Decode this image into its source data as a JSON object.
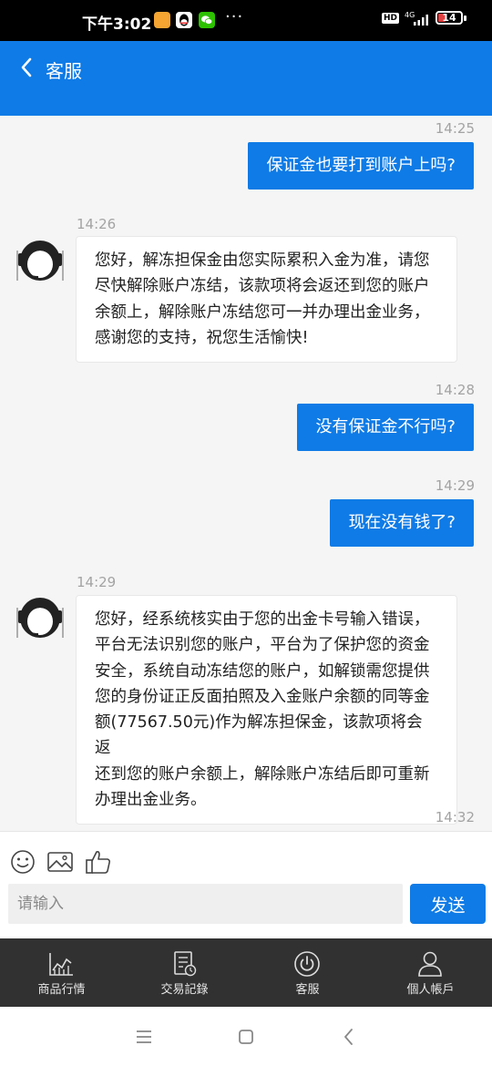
{
  "status_bar": {
    "time": "下午3:02",
    "network": "4G",
    "battery": "14"
  },
  "header": {
    "title": "客服"
  },
  "chat": {
    "messages": [
      {
        "side": "out",
        "time": "14:25",
        "text": "保证金也要打到账户上吗?"
      },
      {
        "side": "in",
        "time": "14:26",
        "text": "您好，解冻担保金由您实际累积入金为准，请您\n尽快解除账户冻结，该款项将会返还到您的账户\n余额上，解除账户冻结您可一并办理出金业务，\n感谢您的支持，祝您生活愉快!"
      },
      {
        "side": "out",
        "time": "14:28",
        "text": "没有保证金不行吗?"
      },
      {
        "side": "out",
        "time": "14:29",
        "text": "现在没有钱了?"
      },
      {
        "side": "in",
        "time": "14:29",
        "text": "您好，经系统核实由于您的出金卡号输入错误，\n平台无法识别您的账户，平台为了保护您的资金\n安全，系统自动冻结您的账户，如解锁需您提供\n您的身份证正反面拍照及入金账户余额的同等金\n额(77567.50元)作为解冻担保金，该款项将会返\n还到您的账户余额上，解除账户冻结后即可重新\n办理出金业务。"
      }
    ],
    "last_time": "14:32"
  },
  "composer": {
    "placeholder": "请输入",
    "send_label": "发送"
  },
  "bottom_nav": [
    {
      "label": "商品行情",
      "icon": "chart-icon"
    },
    {
      "label": "交易記錄",
      "icon": "record-icon"
    },
    {
      "label": "客服",
      "icon": "power-icon"
    },
    {
      "label": "個人帳戶",
      "icon": "person-icon"
    }
  ],
  "colors": {
    "brand": "#0f7be6",
    "nav_bg": "#313131",
    "chat_bg": "#f5f5f5"
  }
}
